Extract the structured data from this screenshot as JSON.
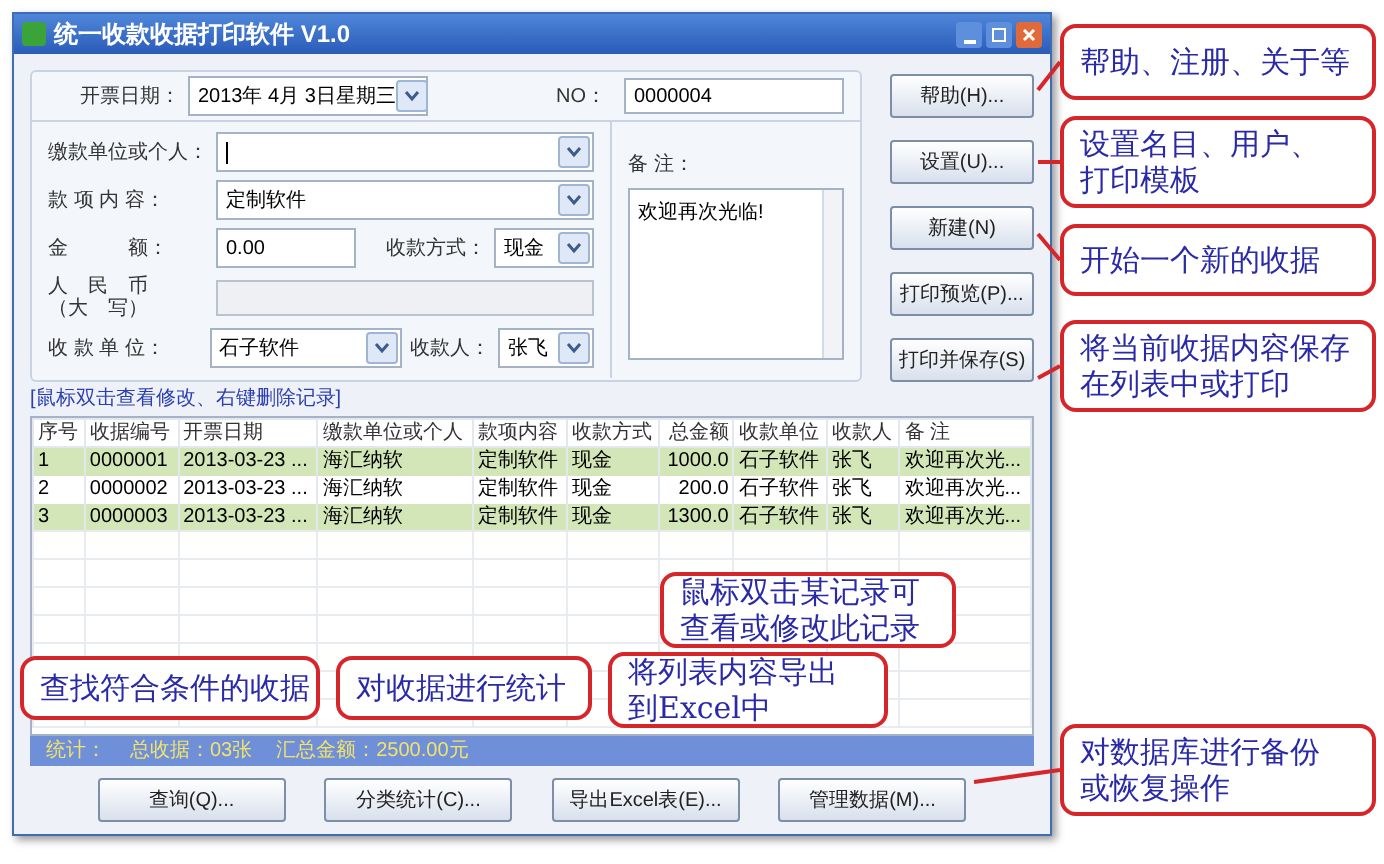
{
  "window": {
    "title": "统一收款收据打印软件 V1.0"
  },
  "form": {
    "date": {
      "label": "开票日期：",
      "value": "2013年 4月 3日星期三"
    },
    "number": {
      "label": "NO：",
      "value": "0000004"
    },
    "payer": {
      "label": "缴款单位或个人："
    },
    "item": {
      "label": "款 项 内 容：",
      "value": "定制软件"
    },
    "amount": {
      "label": "金　　　额：",
      "value": "0.00"
    },
    "method": {
      "label": "收款方式：",
      "value": "现金"
    },
    "rmb": {
      "label": "人　民　币",
      "sub": "（大　写）"
    },
    "unit": {
      "label": "收 款 单 位：",
      "value": "石子软件"
    },
    "payee": {
      "label": "收款人：",
      "value": "张飞"
    },
    "remark": {
      "label": "备 注：",
      "value": "欢迎再次光临!"
    }
  },
  "side_buttons": [
    "帮助(H)...",
    "设置(U)...",
    "新建(N)",
    "打印预览(P)...",
    "打印并保存(S)"
  ],
  "hint": "[鼠标双击查看修改、右键删除记录]",
  "table": {
    "columns": [
      "序号",
      "收据编号",
      "开票日期",
      "缴款单位或个人",
      "款项内容",
      "收款方式",
      "总金额",
      "收款单位",
      "收款人",
      "备 注"
    ],
    "rows": [
      {
        "cells": [
          "1",
          "0000001",
          "2013-03-23 ...",
          "海汇纳软",
          "定制软件",
          "现金",
          "1000.0",
          "石子软件",
          "张飞",
          "欢迎再次光..."
        ],
        "highlighted": true
      },
      {
        "cells": [
          "2",
          "0000002",
          "2013-03-23 ...",
          "海汇纳软",
          "定制软件",
          "现金",
          "200.0",
          "石子软件",
          "张飞",
          "欢迎再次光..."
        ],
        "highlighted": false
      },
      {
        "cells": [
          "3",
          "0000003",
          "2013-03-23 ...",
          "海汇纳软",
          "定制软件",
          "现金",
          "1300.0",
          "石子软件",
          "张飞",
          "欢迎再次光..."
        ],
        "highlighted": true
      }
    ]
  },
  "status_bar": {
    "label": "统计：",
    "count": "总收据：03张",
    "total": "汇总金额：2500.00元"
  },
  "bottom_buttons": [
    "查询(Q)...",
    "分类统计(C)...",
    "导出Excel表(E)...",
    "管理数据(M)..."
  ],
  "callouts": [
    {
      "lines": [
        "帮助、注册、关于等"
      ]
    },
    {
      "lines": [
        "设置名目、用户、",
        "打印模板"
      ]
    },
    {
      "lines": [
        "开始一个新的收据"
      ]
    },
    {
      "lines": [
        "将当前收据内容保存",
        "在列表中或打印"
      ]
    },
    {
      "lines": [
        "鼠标双击某记录可",
        "查看或修改此记录"
      ]
    },
    {
      "lines": [
        "查找符合条件的收据"
      ]
    },
    {
      "lines": [
        "对收据进行统计"
      ]
    },
    {
      "lines": [
        "将列表内容导出",
        "到Excel中"
      ]
    },
    {
      "lines": [
        "对数据库进行备份",
        "或恢复操作"
      ]
    }
  ]
}
